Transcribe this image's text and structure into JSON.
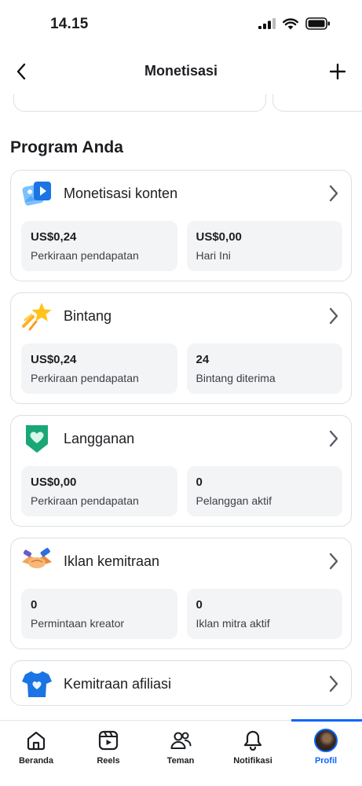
{
  "status_bar": {
    "time": "14.15"
  },
  "header": {
    "title": "Monetisasi"
  },
  "section_title": "Program Anda",
  "cards": [
    {
      "title": "Monetisasi konten",
      "icon": "photo-video-icon",
      "stats": [
        {
          "value": "US$0,24",
          "label": "Perkiraan pendapatan"
        },
        {
          "value": "US$0,00",
          "label": "Hari Ini"
        }
      ]
    },
    {
      "title": "Bintang",
      "icon": "shooting-star-icon",
      "stats": [
        {
          "value": "US$0,24",
          "label": "Perkiraan pendapatan"
        },
        {
          "value": "24",
          "label": "Bintang diterima"
        }
      ]
    },
    {
      "title": "Langganan",
      "icon": "heart-badge-icon",
      "stats": [
        {
          "value": "US$0,00",
          "label": "Perkiraan pendapatan"
        },
        {
          "value": "0",
          "label": "Pelanggan aktif"
        }
      ]
    },
    {
      "title": "Iklan kemitraan",
      "icon": "handshake-icon",
      "stats": [
        {
          "value": "0",
          "label": "Permintaan kreator"
        },
        {
          "value": "0",
          "label": "Iklan mitra aktif"
        }
      ]
    },
    {
      "title": "Kemitraan afiliasi",
      "icon": "tshirt-heart-icon"
    }
  ],
  "bottom_nav": [
    {
      "label": "Beranda",
      "icon": "home-icon"
    },
    {
      "label": "Reels",
      "icon": "reels-icon"
    },
    {
      "label": "Teman",
      "icon": "friends-icon"
    },
    {
      "label": "Notifikasi",
      "icon": "bell-icon"
    },
    {
      "label": "Profil",
      "icon": "avatar",
      "active": true
    }
  ],
  "colors": {
    "accent": "#0866ff",
    "card_border": "#dcdfe3",
    "stat_bg": "#f3f4f6"
  }
}
